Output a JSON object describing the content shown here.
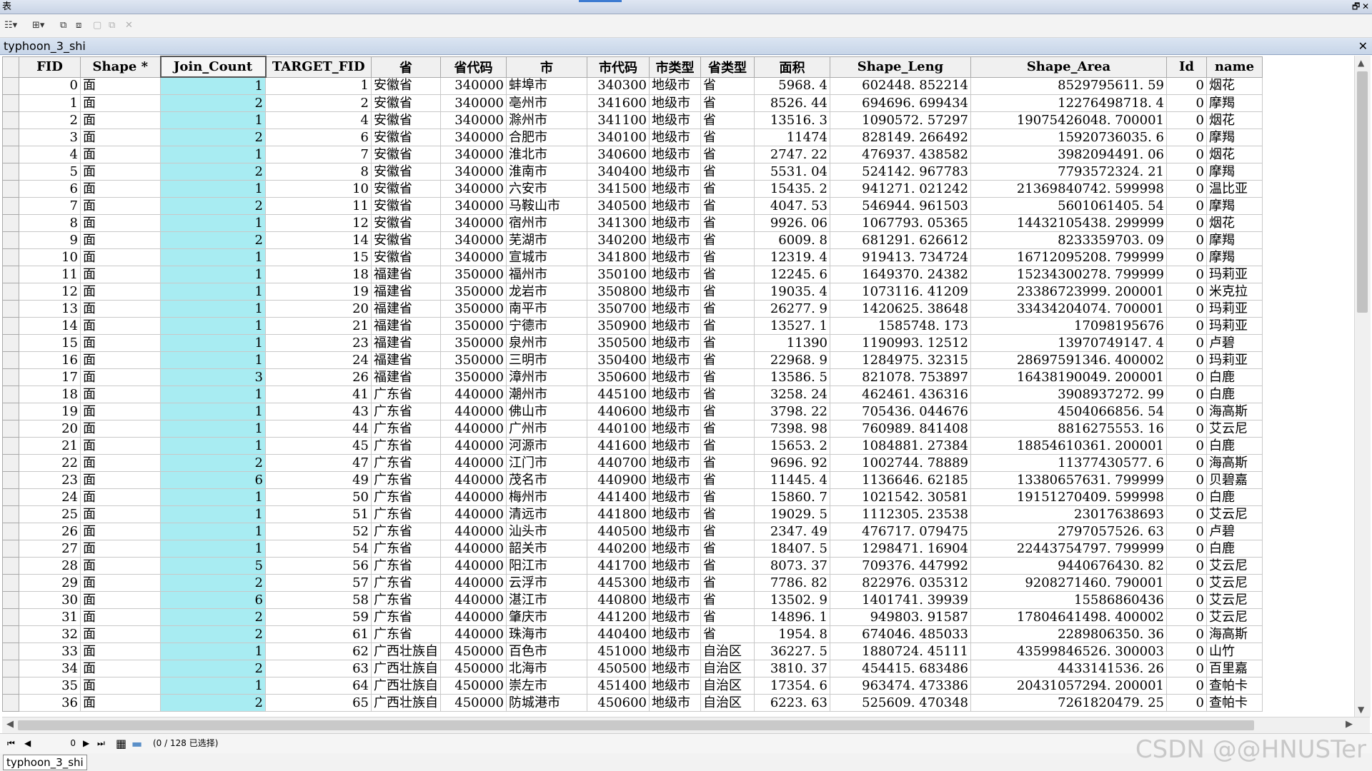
{
  "window": {
    "title": "表",
    "restore_glyph": "🗗",
    "close_glyph": "✕"
  },
  "toolbar": {
    "icons": [
      {
        "name": "table-options-icon",
        "glyph": "☷▾"
      },
      {
        "name": "related-tables-icon",
        "glyph": "⊞▾"
      },
      {
        "name": "select-by-attributes-icon",
        "glyph": "⧉"
      },
      {
        "name": "switch-selection-icon",
        "glyph": "⧈"
      },
      {
        "name": "clear-selection-icon",
        "glyph": "▢"
      },
      {
        "name": "zoom-to-selected-icon",
        "glyph": "⧉"
      },
      {
        "name": "delete-selected-icon",
        "glyph": "✕"
      }
    ]
  },
  "tab": {
    "name": "typhoon_3_shi",
    "close_glyph": "✕"
  },
  "table": {
    "columns": [
      "FID",
      "Shape *",
      "Join_Count",
      "TARGET_FID",
      "省",
      "省代码",
      "市",
      "市代码",
      "市类型",
      "省类型",
      "面积",
      "Shape_Leng",
      "Shape_Area",
      "Id",
      "name"
    ],
    "rows": [
      [
        "0",
        "面",
        "1",
        "1",
        "安徽省",
        "340000",
        "蚌埠市",
        "340300",
        "地级市",
        "省",
        "5968. 4",
        "602448. 852214",
        "8529795611. 59",
        "0",
        "烟花"
      ],
      [
        "1",
        "面",
        "2",
        "2",
        "安徽省",
        "340000",
        "亳州市",
        "341600",
        "地级市",
        "省",
        "8526. 44",
        "694696. 699434",
        "12276498718. 4",
        "0",
        "摩羯"
      ],
      [
        "2",
        "面",
        "1",
        "4",
        "安徽省",
        "340000",
        "滁州市",
        "341100",
        "地级市",
        "省",
        "13516. 3",
        "1090572. 57297",
        "19075426048. 700001",
        "0",
        "烟花"
      ],
      [
        "3",
        "面",
        "2",
        "6",
        "安徽省",
        "340000",
        "合肥市",
        "340100",
        "地级市",
        "省",
        "11474",
        "828149. 266492",
        "15920736035. 6",
        "0",
        "摩羯"
      ],
      [
        "4",
        "面",
        "1",
        "7",
        "安徽省",
        "340000",
        "淮北市",
        "340600",
        "地级市",
        "省",
        "2747. 22",
        "476937. 438582",
        "3982094491. 06",
        "0",
        "烟花"
      ],
      [
        "5",
        "面",
        "2",
        "8",
        "安徽省",
        "340000",
        "淮南市",
        "340400",
        "地级市",
        "省",
        "5531. 04",
        "524142. 967783",
        "7793572324. 21",
        "0",
        "摩羯"
      ],
      [
        "6",
        "面",
        "1",
        "10",
        "安徽省",
        "340000",
        "六安市",
        "341500",
        "地级市",
        "省",
        "15435. 2",
        "941271. 021242",
        "21369840742. 599998",
        "0",
        "温比亚"
      ],
      [
        "7",
        "面",
        "2",
        "11",
        "安徽省",
        "340000",
        "马鞍山市",
        "340500",
        "地级市",
        "省",
        "4047. 53",
        "546944. 961503",
        "5601061405. 54",
        "0",
        "摩羯"
      ],
      [
        "8",
        "面",
        "1",
        "12",
        "安徽省",
        "340000",
        "宿州市",
        "341300",
        "地级市",
        "省",
        "9926. 06",
        "1067793. 05365",
        "14432105438. 299999",
        "0",
        "烟花"
      ],
      [
        "9",
        "面",
        "2",
        "14",
        "安徽省",
        "340000",
        "芜湖市",
        "340200",
        "地级市",
        "省",
        "6009. 8",
        "681291. 626612",
        "8233359703. 09",
        "0",
        "摩羯"
      ],
      [
        "10",
        "面",
        "1",
        "15",
        "安徽省",
        "340000",
        "宣城市",
        "341800",
        "地级市",
        "省",
        "12319. 4",
        "919413. 734724",
        "16712095208. 799999",
        "0",
        "摩羯"
      ],
      [
        "11",
        "面",
        "1",
        "18",
        "福建省",
        "350000",
        "福州市",
        "350100",
        "地级市",
        "省",
        "12245. 6",
        "1649370. 24382",
        "15234300278. 799999",
        "0",
        "玛莉亚"
      ],
      [
        "12",
        "面",
        "1",
        "19",
        "福建省",
        "350000",
        "龙岩市",
        "350800",
        "地级市",
        "省",
        "19035. 4",
        "1073116. 41209",
        "23386723999. 200001",
        "0",
        "米克拉"
      ],
      [
        "13",
        "面",
        "1",
        "20",
        "福建省",
        "350000",
        "南平市",
        "350700",
        "地级市",
        "省",
        "26277. 9",
        "1420625. 38648",
        "33434204074. 700001",
        "0",
        "玛莉亚"
      ],
      [
        "14",
        "面",
        "1",
        "21",
        "福建省",
        "350000",
        "宁德市",
        "350900",
        "地级市",
        "省",
        "13527. 1",
        "1585748. 173",
        "17098195676",
        "0",
        "玛莉亚"
      ],
      [
        "15",
        "面",
        "1",
        "23",
        "福建省",
        "350000",
        "泉州市",
        "350500",
        "地级市",
        "省",
        "11390",
        "1190993. 12512",
        "13970749147. 4",
        "0",
        "卢碧"
      ],
      [
        "16",
        "面",
        "1",
        "24",
        "福建省",
        "350000",
        "三明市",
        "350400",
        "地级市",
        "省",
        "22968. 9",
        "1284975. 32315",
        "28697591346. 400002",
        "0",
        "玛莉亚"
      ],
      [
        "17",
        "面",
        "3",
        "26",
        "福建省",
        "350000",
        "漳州市",
        "350600",
        "地级市",
        "省",
        "13586. 5",
        "821078. 753897",
        "16438190049. 200001",
        "0",
        "白鹿"
      ],
      [
        "18",
        "面",
        "1",
        "41",
        "广东省",
        "440000",
        "潮州市",
        "445100",
        "地级市",
        "省",
        "3258. 24",
        "462461. 436316",
        "3908937272. 99",
        "0",
        "白鹿"
      ],
      [
        "19",
        "面",
        "1",
        "43",
        "广东省",
        "440000",
        "佛山市",
        "440600",
        "地级市",
        "省",
        "3798. 22",
        "705436. 044676",
        "4504066856. 54",
        "0",
        "海高斯"
      ],
      [
        "20",
        "面",
        "1",
        "44",
        "广东省",
        "440000",
        "广州市",
        "440100",
        "地级市",
        "省",
        "7398. 98",
        "760989. 841408",
        "8816275553. 16",
        "0",
        "艾云尼"
      ],
      [
        "21",
        "面",
        "1",
        "45",
        "广东省",
        "440000",
        "河源市",
        "441600",
        "地级市",
        "省",
        "15653. 2",
        "1084881. 27384",
        "18854610361. 200001",
        "0",
        "白鹿"
      ],
      [
        "22",
        "面",
        "2",
        "47",
        "广东省",
        "440000",
        "江门市",
        "440700",
        "地级市",
        "省",
        "9696. 92",
        "1002744. 78889",
        "11377430577. 6",
        "0",
        "海高斯"
      ],
      [
        "23",
        "面",
        "6",
        "49",
        "广东省",
        "440000",
        "茂名市",
        "440900",
        "地级市",
        "省",
        "11445. 4",
        "1136646. 62185",
        "13380657631. 799999",
        "0",
        "贝碧嘉"
      ],
      [
        "24",
        "面",
        "1",
        "50",
        "广东省",
        "440000",
        "梅州市",
        "441400",
        "地级市",
        "省",
        "15860. 7",
        "1021542. 30581",
        "19151270409. 599998",
        "0",
        "白鹿"
      ],
      [
        "25",
        "面",
        "1",
        "51",
        "广东省",
        "440000",
        "清远市",
        "441800",
        "地级市",
        "省",
        "19029. 5",
        "1112305. 23538",
        "23017638693",
        "0",
        "艾云尼"
      ],
      [
        "26",
        "面",
        "1",
        "52",
        "广东省",
        "440000",
        "汕头市",
        "440500",
        "地级市",
        "省",
        "2347. 49",
        "476717. 079475",
        "2797057526. 63",
        "0",
        "卢碧"
      ],
      [
        "27",
        "面",
        "1",
        "54",
        "广东省",
        "440000",
        "韶关市",
        "440200",
        "地级市",
        "省",
        "18407. 5",
        "1298471. 16904",
        "22443754797. 799999",
        "0",
        "白鹿"
      ],
      [
        "28",
        "面",
        "5",
        "56",
        "广东省",
        "440000",
        "阳江市",
        "441700",
        "地级市",
        "省",
        "8073. 37",
        "709376. 447992",
        "9440676430. 82",
        "0",
        "艾云尼"
      ],
      [
        "29",
        "面",
        "2",
        "57",
        "广东省",
        "440000",
        "云浮市",
        "445300",
        "地级市",
        "省",
        "7786. 82",
        "822976. 035312",
        "9208271460. 790001",
        "0",
        "艾云尼"
      ],
      [
        "30",
        "面",
        "6",
        "58",
        "广东省",
        "440000",
        "湛江市",
        "440800",
        "地级市",
        "省",
        "13502. 9",
        "1401741. 39939",
        "15586860436",
        "0",
        "艾云尼"
      ],
      [
        "31",
        "面",
        "2",
        "59",
        "广东省",
        "440000",
        "肇庆市",
        "441200",
        "地级市",
        "省",
        "14896. 1",
        "949803. 91587",
        "17804641498. 400002",
        "0",
        "艾云尼"
      ],
      [
        "32",
        "面",
        "2",
        "61",
        "广东省",
        "440000",
        "珠海市",
        "440400",
        "地级市",
        "省",
        "1954. 8",
        "674046. 485033",
        "2289806350. 36",
        "0",
        "海高斯"
      ],
      [
        "33",
        "面",
        "1",
        "62",
        "广西壮族自",
        "450000",
        "百色市",
        "451000",
        "地级市",
        "自治区",
        "36227. 5",
        "1880724. 45111",
        "43599846526. 300003",
        "0",
        "山竹"
      ],
      [
        "34",
        "面",
        "2",
        "63",
        "广西壮族自",
        "450000",
        "北海市",
        "450500",
        "地级市",
        "自治区",
        "3810. 37",
        "454415. 683486",
        "4433141536. 26",
        "0",
        "百里嘉"
      ],
      [
        "35",
        "面",
        "1",
        "64",
        "广西壮族自",
        "450000",
        "崇左市",
        "451400",
        "地级市",
        "自治区",
        "17354. 6",
        "963474. 473386",
        "20431057294. 200001",
        "0",
        "查帕卡"
      ],
      [
        "36",
        "面",
        "2",
        "65",
        "广西壮族自",
        "450000",
        "防城港市",
        "450600",
        "地级市",
        "自治区",
        "6223. 63",
        "525609. 470348",
        "7261820479. 25",
        "0",
        "查帕卡"
      ]
    ]
  },
  "navigation": {
    "first_glyph": "⏮",
    "prev_glyph": "◀",
    "current_record": "0",
    "next_glyph": "▶",
    "last_glyph": "⏭",
    "show_all_glyph": "▦",
    "show_selected_glyph": "▬",
    "selection_status": "(0 / 128 已选择)"
  },
  "bottom_tab": {
    "name": "typhoon_3_shi"
  },
  "watermark": "CSDN @@HNUSTer",
  "colors": {
    "selected_column": "#a8ecf2",
    "header_bg": "#f0f0f0"
  }
}
